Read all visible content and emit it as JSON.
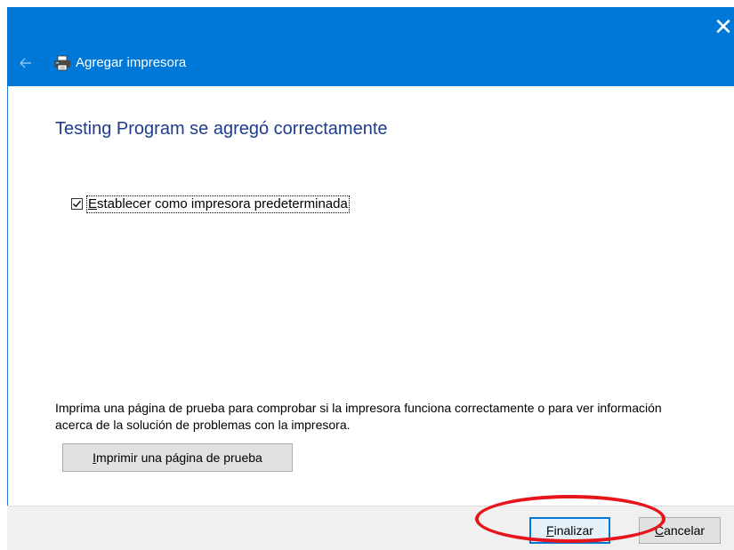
{
  "window": {
    "title": "Agregar impresora",
    "close_glyph": "✕",
    "back_icon": "back-arrow-icon",
    "title_icon": "printer-icon",
    "accent_color": "#0078d7"
  },
  "content": {
    "heading": "Testing Program se agregó correctamente",
    "checkbox": {
      "checked": true,
      "label_access_key": "E",
      "label_rest": "stablecer como impresora predeterminada"
    },
    "info_text": "Imprima una página de prueba para comprobar si la impresora funciona correctamente o para ver información acerca de la solución de problemas con la impresora.",
    "test_page_button": {
      "access_key": "I",
      "rest": "mprimir una página de prueba"
    }
  },
  "footer": {
    "finish_button": {
      "access_key": "F",
      "rest": "inalizar"
    },
    "cancel_button": {
      "access_key": "C",
      "rest": "ancelar"
    }
  },
  "annotation": {
    "shape": "ellipse",
    "color": "#e8141c",
    "target": "finish-button"
  }
}
